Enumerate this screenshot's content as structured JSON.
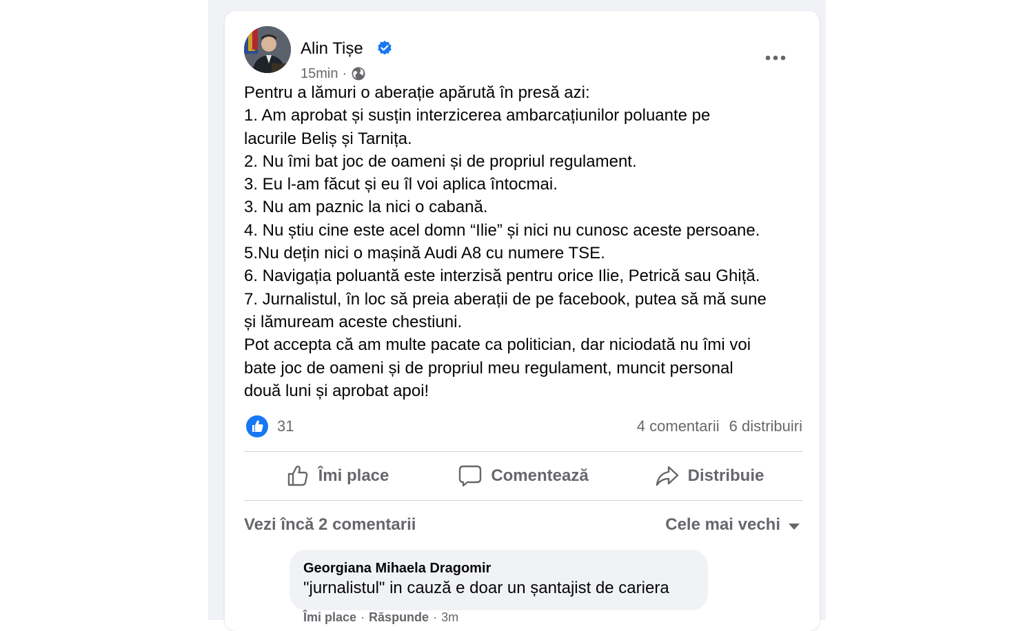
{
  "post": {
    "author": "Alin Tișe",
    "time": "15min",
    "separator": "·",
    "lines": [
      "Pentru a lămuri o aberație apărută în presă azi:",
      "1.  Am aprobat și susțin interzicerea ambarcațiunilor poluante pe",
      "lacurile Beliș și Tarnița.",
      "2. Nu îmi bat joc de oameni și de propriul regulament.",
      "3. Eu l-am făcut și eu îl voi aplica întocmai.",
      "3. Nu am paznic la nici o cabană.",
      "4. Nu știu cine este acel domn “Ilie” și nici nu cunosc aceste persoane.",
      "5.Nu dețin nici o mașină Audi A8 cu numere TSE.",
      "6. Navigația poluantă este interzisă pentru orice Ilie, Petrică sau Ghiță.",
      "7. Jurnalistul, în loc să preia aberații de pe facebook, putea să mă sune",
      "și lămuream aceste chestiuni.",
      "Pot accepta că am multe pacate ca politician, dar niciodată nu îmi voi",
      "bate joc de oameni și de propriul meu regulament, muncit personal",
      "două luni și aprobat apoi!"
    ]
  },
  "stats": {
    "likes": "31",
    "comments": "4 comentarii",
    "shares": "6 distribuiri"
  },
  "actions": {
    "like": "Îmi place",
    "comment": "Comentează",
    "share": "Distribuie"
  },
  "comments": {
    "see_more": "Vezi încă 2 comentarii",
    "sort": "Cele mai vechi",
    "items": [
      {
        "author": "Georgiana Mihaela Dragomir",
        "text": "\"jurnalistul\" in cauză e doar un șantajist de cariera",
        "like": "Îmi place",
        "reply": "Răspunde",
        "dot": "·",
        "time": "3m"
      }
    ]
  },
  "colors": {
    "accent": "#1877f2",
    "secondary_text": "#65676b",
    "bubble": "#f0f2f5"
  }
}
